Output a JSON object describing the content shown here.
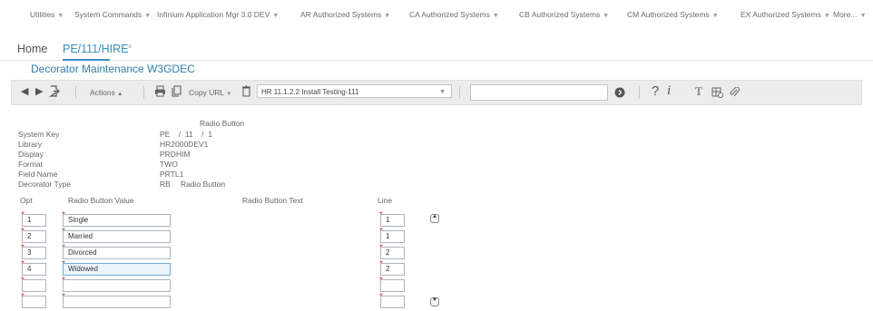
{
  "top_menu": [
    {
      "label": "Utilities"
    },
    {
      "label": "System Commands"
    },
    {
      "label": "Infinium Application Mgr 3.0 DEV"
    },
    {
      "label": "AR Authorized Systems"
    },
    {
      "label": "CA Authorized Systems"
    },
    {
      "label": "CB Authorized Systems"
    },
    {
      "label": "CM Authorized Systems"
    },
    {
      "label": "EX Authorized Systems"
    },
    {
      "label": "More..."
    }
  ],
  "menu_caret": "▼",
  "tabs": {
    "home": "Home",
    "active": "PE/111/HIRE",
    "active_badge": "x"
  },
  "screen_title": "Decorator Maintenance W3GDEC",
  "toolbar": {
    "actions_label": "Actions",
    "copy_url_label": "Copy URL",
    "environment": "HR 11.1.2.2 Install Testing-111",
    "search_value": "",
    "help_glyph": "?",
    "info_glyph": "i",
    "text_glyph": "T"
  },
  "form": {
    "radio_button_heading": "Radio Button",
    "labels": {
      "system_key": "System Key",
      "library": "Library",
      "display": "Display",
      "format": "Format",
      "field_name": "Field Name",
      "decorator_type": "Decorator Type"
    },
    "values": {
      "system_key": "PE    /  11    /  1",
      "library": "HR2000DEV1",
      "display": "PRDHIM",
      "format": "TWO",
      "field_name": "PRTL1",
      "decorator_type": "RB",
      "decorator_type_desc": "Radio Button"
    }
  },
  "grid": {
    "headers": {
      "opt": "Opt",
      "value": "Radio Button Value",
      "text": "Radio Button Text",
      "line": "Line"
    },
    "rows": [
      {
        "opt": "1",
        "value": "Single",
        "line": "1"
      },
      {
        "opt": "2",
        "value": "Married",
        "line": "1"
      },
      {
        "opt": "3",
        "value": "Divorced",
        "line": "2"
      },
      {
        "opt": "4",
        "value": "Widowed",
        "line": "2"
      },
      {
        "opt": "",
        "value": "",
        "line": ""
      },
      {
        "opt": "",
        "value": "",
        "line": ""
      }
    ],
    "required_marker": "*"
  }
}
